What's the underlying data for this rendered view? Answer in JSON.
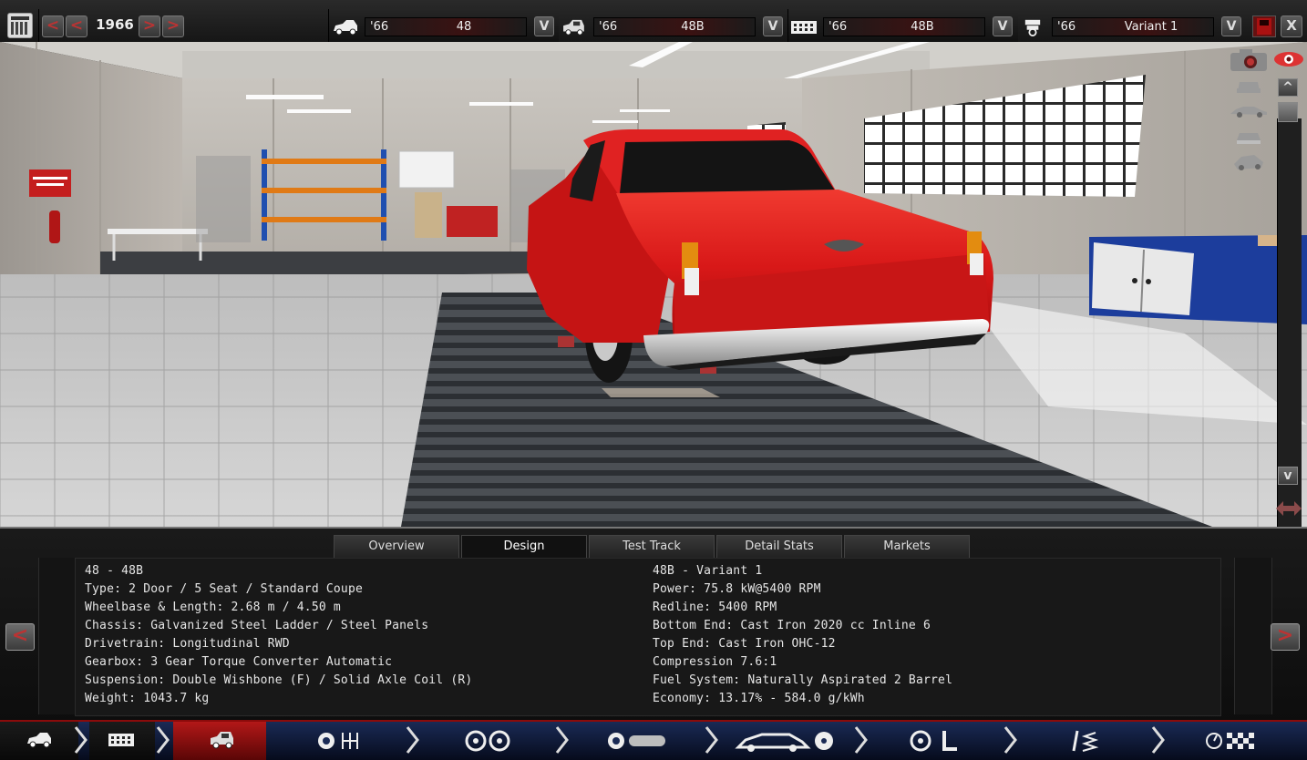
{
  "top_bar": {
    "year": "1966",
    "prev_label": "<",
    "next_label": ">",
    "dropdown_label": "V",
    "selectors": [
      {
        "year": "'66",
        "name": "48"
      },
      {
        "year": "'66",
        "name": "48B"
      },
      {
        "year": "'66",
        "name": "48B"
      },
      {
        "year": "'66",
        "name": "Variant 1"
      }
    ],
    "close_label": "X"
  },
  "scroll": {
    "up_label": "^",
    "down_label": "v"
  },
  "tabs": [
    {
      "label": "Overview",
      "active": false
    },
    {
      "label": "Design",
      "active": true
    },
    {
      "label": "Test Track",
      "active": false
    },
    {
      "label": "Detail Stats",
      "active": false
    },
    {
      "label": "Markets",
      "active": false
    }
  ],
  "details": {
    "left": [
      "48 - 48B",
      "Type: 2 Door / 5 Seat / Standard Coupe",
      "Wheelbase & Length: 2.68 m / 4.50 m",
      "Chassis: Galvanized Steel Ladder / Steel Panels",
      "Drivetrain: Longitudinal RWD",
      "Gearbox: 3 Gear Torque Converter Automatic",
      "Suspension: Double Wishbone (F) / Solid Axle Coil (R)",
      "Weight: 1043.7 kg"
    ],
    "right": [
      "48B - Variant 1",
      "Power: 75.8 kW@5400 RPM",
      "Redline: 5400 RPM",
      "Bottom End: Cast Iron 2020 cc Inline 6",
      "Top End: Cast Iron OHC-12",
      "Compression 7.6:1",
      "Fuel System: Naturally Aspirated 2 Barrel",
      "Economy: 13.17% - 584.0 g/kWh"
    ]
  },
  "nav": {
    "prev_label": "<",
    "next_label": ">"
  },
  "colors": {
    "accent_red": "#b21818",
    "car_red": "#d81818",
    "step_blue": "#1a2a55"
  }
}
